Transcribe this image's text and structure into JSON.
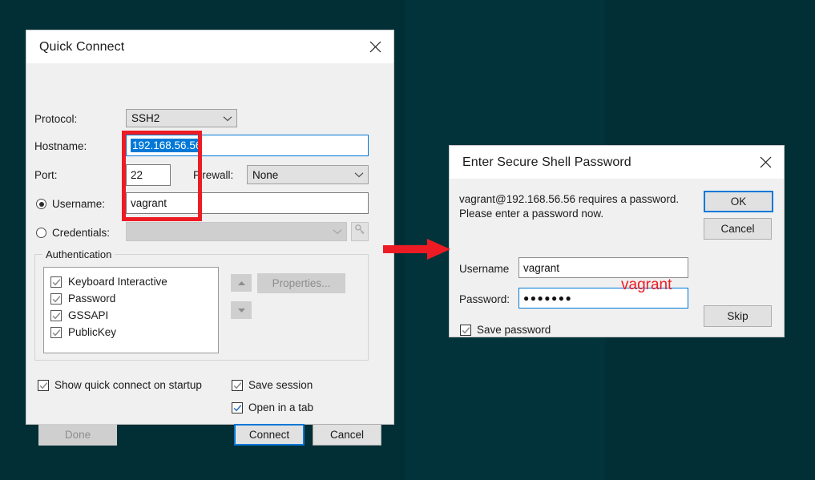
{
  "desktop": {
    "background_color": "#022e35"
  },
  "quick_connect": {
    "title": "Quick Connect",
    "close_icon": "close-icon",
    "protocol": {
      "label": "Protocol:",
      "value": "SSH2"
    },
    "hostname": {
      "label": "Hostname:",
      "value": "192.168.56.56"
    },
    "port": {
      "label": "Port:",
      "value": "22"
    },
    "firewall": {
      "label": "Firewall:",
      "value": "None"
    },
    "username": {
      "label": "Username:",
      "value": "vagrant",
      "selected": true
    },
    "credentials": {
      "label": "Credentials:",
      "value": "",
      "selected": false,
      "key_icon": "key-icon"
    },
    "authentication": {
      "title": "Authentication",
      "items": [
        {
          "label": "Keyboard Interactive",
          "checked": true
        },
        {
          "label": "Password",
          "checked": true
        },
        {
          "label": "GSSAPI",
          "checked": true
        },
        {
          "label": "PublicKey",
          "checked": true
        }
      ],
      "move_up_icon": "arrow-up-icon",
      "move_down_icon": "arrow-down-icon",
      "properties_label": "Properties..."
    },
    "options": [
      {
        "label": "Show quick connect on startup",
        "checked": true
      },
      {
        "label": "Save session",
        "checked": true
      },
      {
        "label": "Open in a tab",
        "checked": true
      }
    ],
    "buttons": {
      "done": "Done",
      "connect": "Connect",
      "cancel": "Cancel"
    }
  },
  "password_dialog": {
    "title": "Enter Secure Shell Password",
    "close_icon": "close-icon",
    "message_line1": "vagrant@192.168.56.56 requires a password.",
    "message_line2": "Please enter a password now.",
    "username": {
      "label": "Username",
      "value": "vagrant"
    },
    "password": {
      "label": "Password:",
      "value": "●●●●●●●"
    },
    "save_password": {
      "label": "Save password",
      "checked": true
    },
    "buttons": {
      "ok": "OK",
      "cancel": "Cancel",
      "skip": "Skip"
    }
  },
  "annotations": {
    "highlight_box_color": "#ed1c24",
    "arrow_color": "#ed1c24",
    "password_note": "vagrant",
    "arrow_icon": "right-arrow-icon"
  }
}
